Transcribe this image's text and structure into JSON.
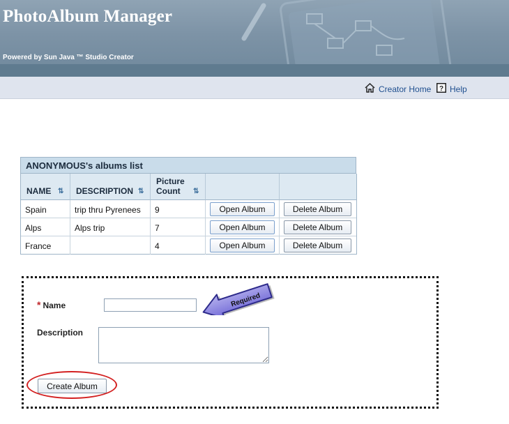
{
  "banner": {
    "title": "PhotoAlbum Manager",
    "powered_by": "Powered by Sun Java ™ Studio Creator"
  },
  "utility": {
    "home_label": "Creator Home",
    "help_label": "Help",
    "home_icon": "home-icon",
    "help_icon": "question-icon"
  },
  "table": {
    "title": "ANONYMOUS's albums list",
    "columns": [
      "NAME",
      "DESCRIPTION",
      "Picture Count"
    ],
    "rows": [
      {
        "name": "Spain",
        "description": "trip thru Pyrenees",
        "count": "9"
      },
      {
        "name": "Alps",
        "description": "Alps trip",
        "count": "7"
      },
      {
        "name": "France",
        "description": "",
        "count": "4"
      }
    ],
    "open_label": "Open Album",
    "delete_label": "Delete Album"
  },
  "form": {
    "required_marker": "*",
    "name_label": "Name",
    "name_value": "",
    "description_label": "Description",
    "description_value": "",
    "create_label": "Create Album",
    "callout_text": "Required"
  },
  "colors": {
    "accent": "#1f4f8f",
    "header_band": "#c9dcea",
    "highlight": "#d32020"
  }
}
